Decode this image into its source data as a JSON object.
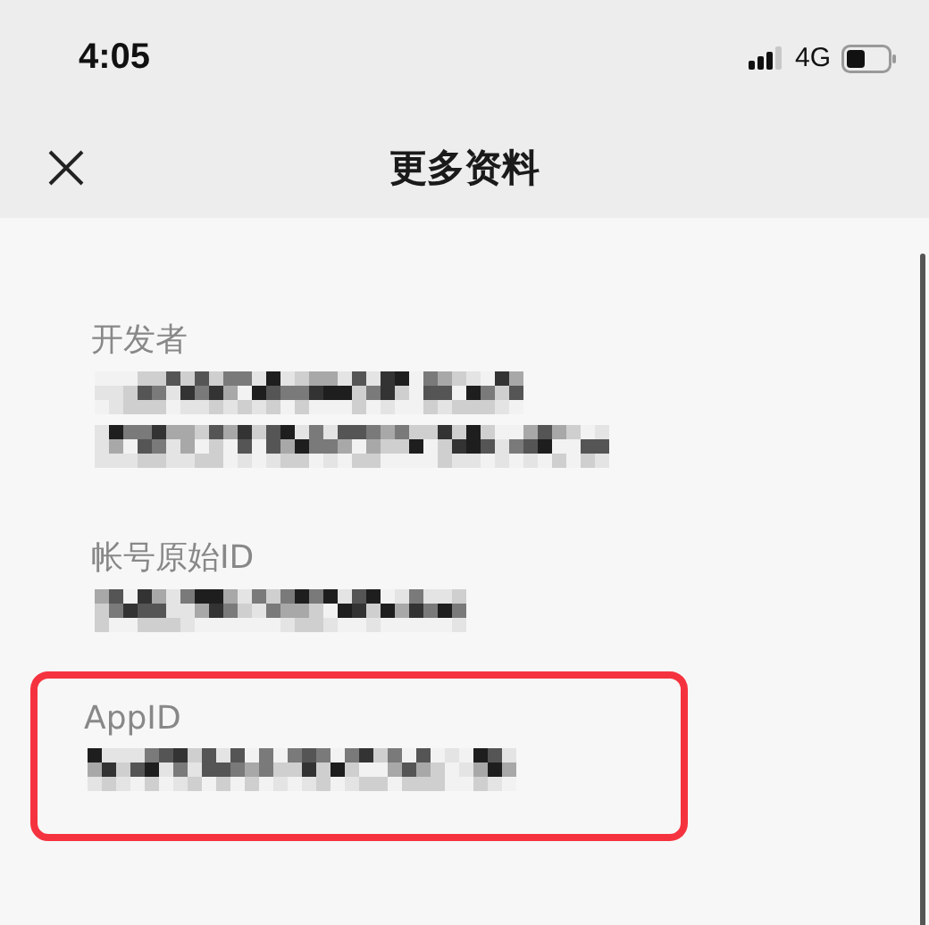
{
  "status_bar": {
    "time": "4:05",
    "network": "4G"
  },
  "nav_bar": {
    "title": "更多资料"
  },
  "sections": [
    {
      "label": "开发者",
      "highlighted": false,
      "value_lines": [
        {
          "kind": "redacted"
        },
        {
          "kind": "redacted"
        }
      ]
    },
    {
      "label": "帐号原始ID",
      "highlighted": false,
      "value_lines": [
        {
          "kind": "redacted"
        }
      ]
    },
    {
      "label": "AppID",
      "highlighted": true,
      "value_lines": [
        {
          "kind": "redacted"
        }
      ]
    }
  ]
}
